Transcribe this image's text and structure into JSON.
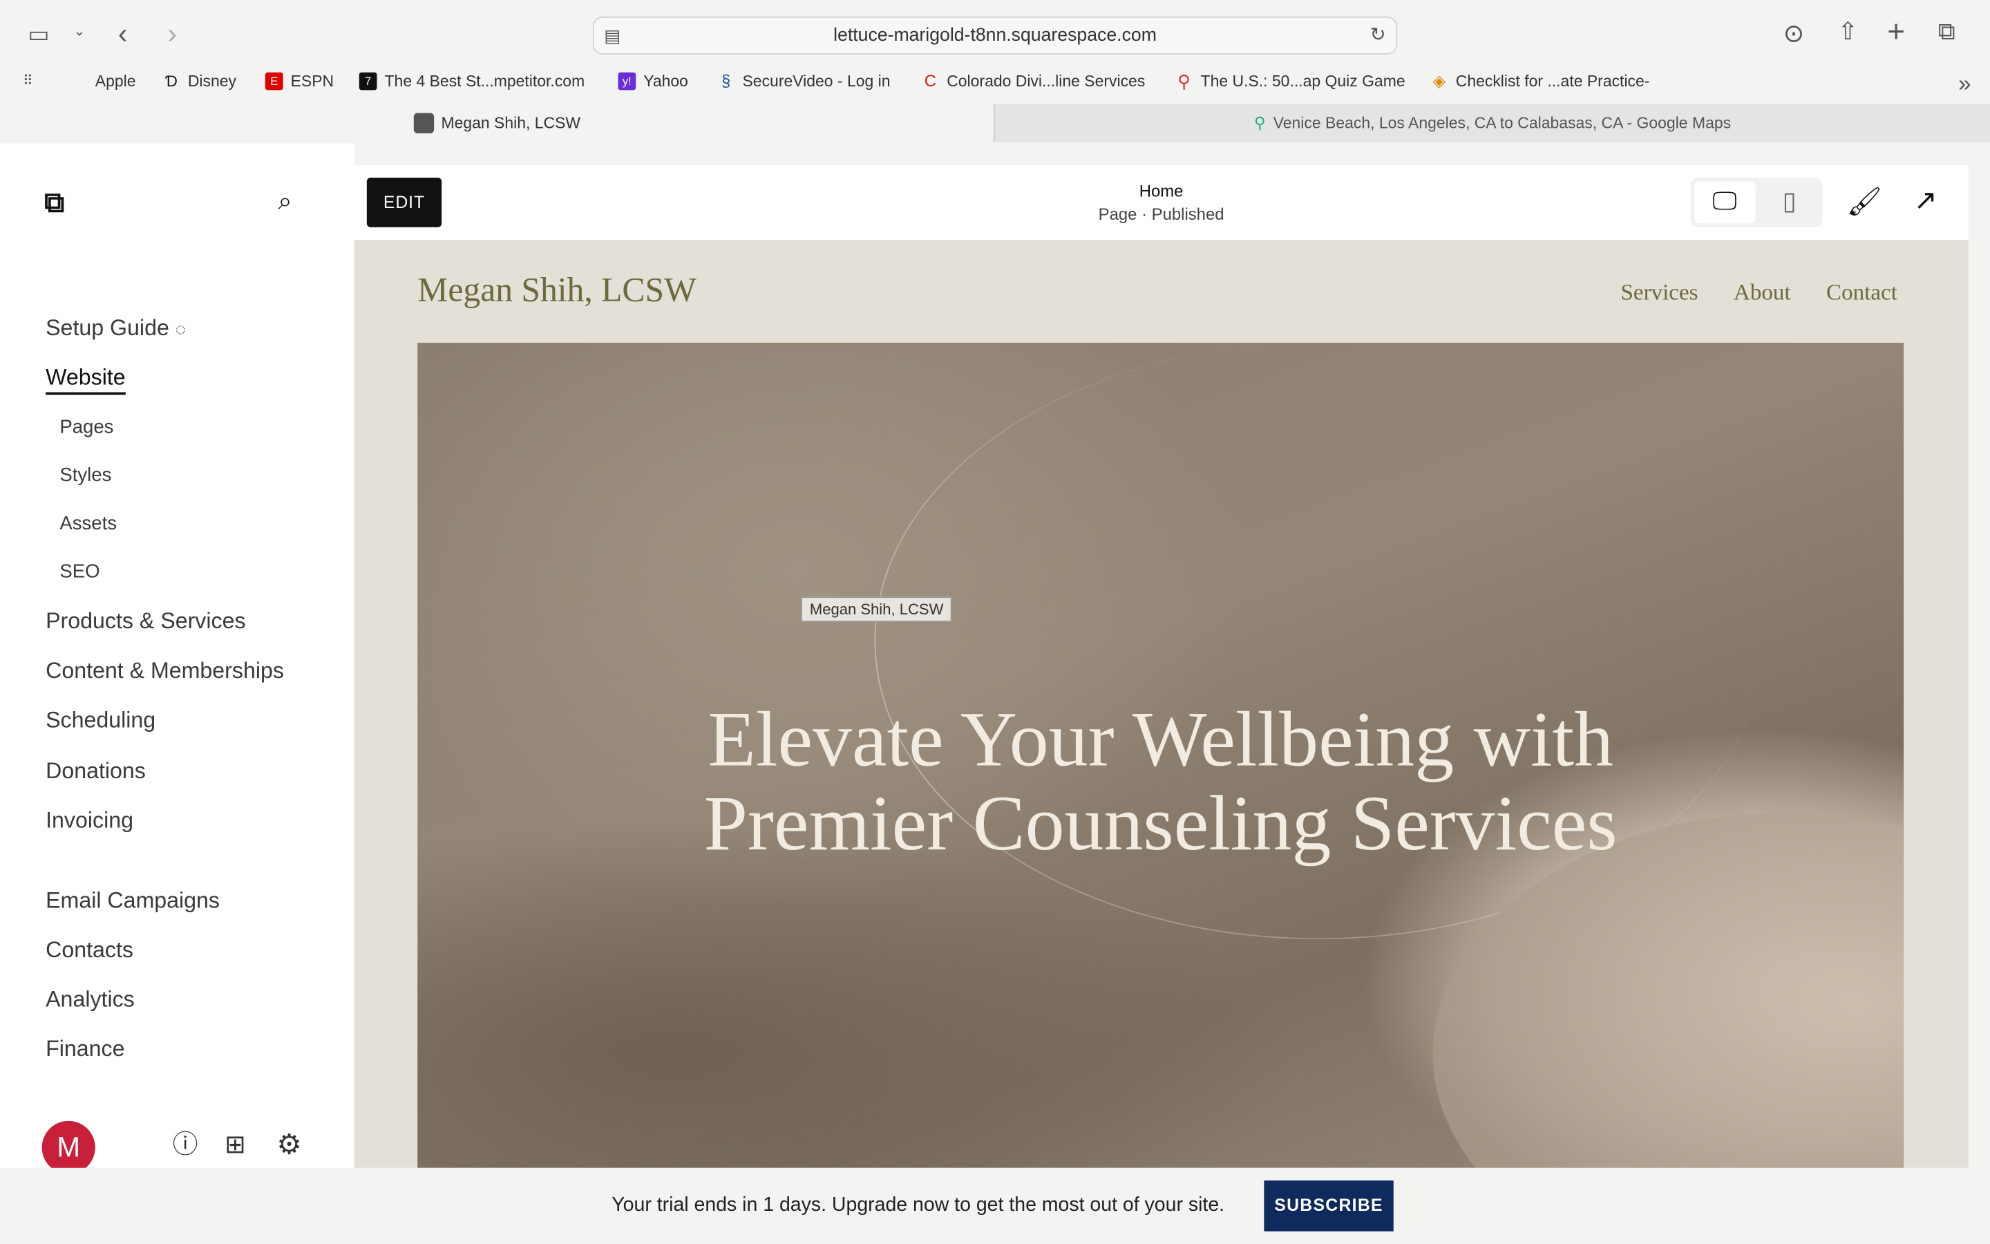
{
  "browser": {
    "url": "lettuce-marigold-t8nn.squarespace.com",
    "bookmarks": [
      "Apple",
      "Disney",
      "ESPN",
      "The 4 Best St...mpetitor.com",
      "Yahoo",
      "SecureVideo - Log in",
      "Colorado Divi...line Services",
      "The U.S.: 50...ap Quiz Game",
      "Checklist for ...ate Practice-"
    ],
    "tabs": [
      "Megan Shih, LCSW",
      "Venice Beach, Los Angeles, CA to Calabasas, CA - Google Maps"
    ]
  },
  "sidebar": {
    "setup_guide": "Setup Guide",
    "website": "Website",
    "website_sub": [
      "Pages",
      "Styles",
      "Assets",
      "SEO"
    ],
    "items": [
      "Products & Services",
      "Content & Memberships",
      "Scheduling",
      "Donations",
      "Invoicing"
    ],
    "items2": [
      "Email Campaigns",
      "Contacts",
      "Analytics",
      "Finance"
    ],
    "avatar": "M"
  },
  "editor": {
    "edit": "EDIT",
    "page_title": "Home",
    "page_status": "Page · Published"
  },
  "site": {
    "title": "Megan Shih, LCSW",
    "nav": [
      "Services",
      "About",
      "Contact"
    ],
    "image_label": "Megan Shih, LCSW",
    "headline1": "Elevate Your Wellbeing with",
    "headline2": "Premier Counseling Services"
  },
  "trial": {
    "message": "Your trial ends in 1 days. Upgrade now to get the most out of your site.",
    "subscribe": "SUBSCRIBE"
  }
}
